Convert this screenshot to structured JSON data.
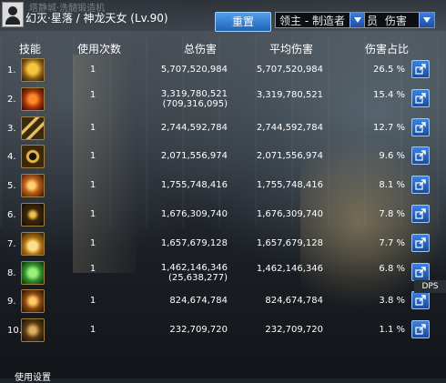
{
  "header": {
    "player": "幻灭·星落 / 神龙天女 (Lv.90)",
    "background_sign": "塔静城·洗髓锻造机",
    "reset_label": "重置",
    "target_select": "领主 - 制造者",
    "target_select_tail": "员",
    "metric_select": "伤害"
  },
  "columns": {
    "skill": "技能",
    "uses": "使用次数",
    "total": "总伤害",
    "avg": "平均伤害",
    "pct": "伤害占比"
  },
  "rows": [
    {
      "rank": "1.",
      "icon": "golden-lion-icon",
      "uses": "1",
      "total": "5,707,520,984",
      "sub": "",
      "avg": "5,707,520,984",
      "pct": "26.5 %"
    },
    {
      "rank": "2.",
      "icon": "flame-vortex-icon",
      "uses": "1",
      "total": "3,319,780,521",
      "sub": "(709,316,095)",
      "avg": "3,319,780,521",
      "pct": "15.4 %"
    },
    {
      "rank": "3.",
      "icon": "crossed-blades-icon",
      "uses": "1",
      "total": "2,744,592,784",
      "sub": "",
      "avg": "2,744,592,784",
      "pct": "12.7 %"
    },
    {
      "rank": "4.",
      "icon": "golden-ring-icon",
      "uses": "1",
      "total": "2,071,556,974",
      "sub": "",
      "avg": "2,071,556,974",
      "pct": "9.6 %"
    },
    {
      "rank": "5.",
      "icon": "orange-swirl-icon",
      "uses": "1",
      "total": "1,755,748,416",
      "sub": "",
      "avg": "1,755,748,416",
      "pct": "8.1 %"
    },
    {
      "rank": "6.",
      "icon": "dark-sigil-icon",
      "uses": "1",
      "total": "1,676,309,740",
      "sub": "",
      "avg": "1,676,309,740",
      "pct": "7.8 %"
    },
    {
      "rank": "7.",
      "icon": "golden-wing-icon",
      "uses": "1",
      "total": "1,657,679,128",
      "sub": "",
      "avg": "1,657,679,128",
      "pct": "7.7 %"
    },
    {
      "rank": "8.",
      "icon": "green-orb-icon",
      "uses": "1",
      "total": "1,462,146,346",
      "sub": "(25,638,277)",
      "avg": "1,462,146,346",
      "pct": "6.8 %"
    },
    {
      "rank": "9.",
      "icon": "dragon-claw-icon",
      "uses": "1",
      "total": "824,674,784",
      "sub": "",
      "avg": "824,674,784",
      "pct": "3.8 %"
    },
    {
      "rank": "10.",
      "icon": "shadow-fist-icon",
      "uses": "1",
      "total": "232,709,720",
      "sub": "",
      "avg": "232,709,720",
      "pct": "1.1 %"
    }
  ],
  "footer": {
    "label": "使用设置"
  },
  "side_tab": "DPS"
}
